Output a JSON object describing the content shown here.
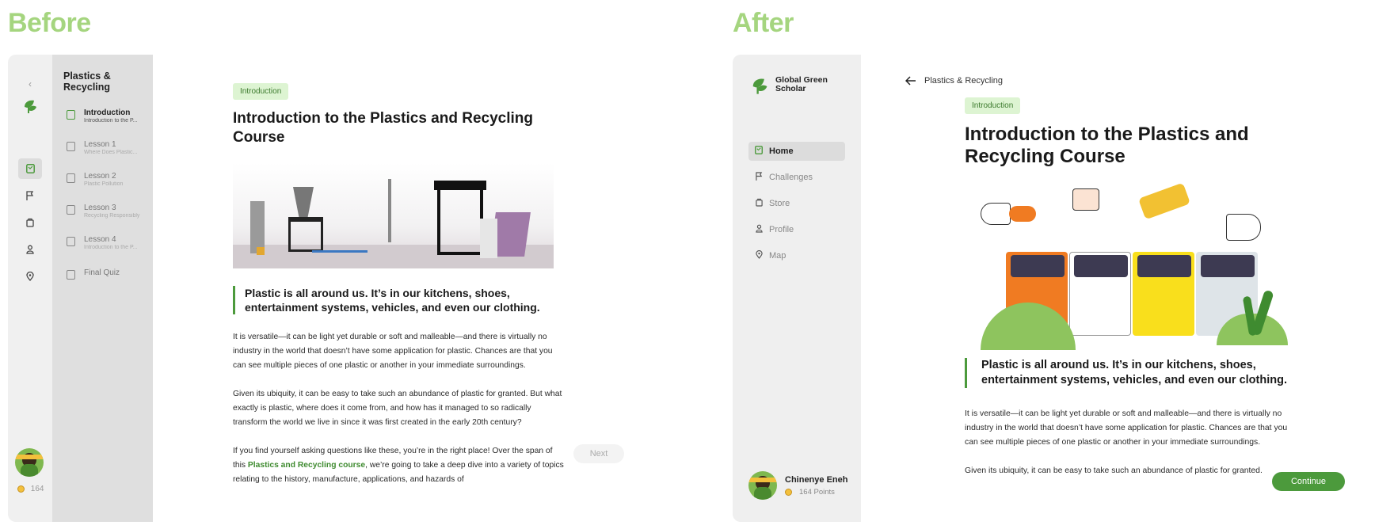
{
  "headings": {
    "before": "Before",
    "after": "After"
  },
  "before": {
    "course_title": "Plastics & Recycling",
    "lessons": [
      {
        "title": "Introduction",
        "subtitle": "Introduction to the P..."
      },
      {
        "title": "Lesson 1",
        "subtitle": "Where Does Plastic..."
      },
      {
        "title": "Lesson 2",
        "subtitle": "Plastic Pollution"
      },
      {
        "title": "Lesson 3",
        "subtitle": "Recycling Responsibly"
      },
      {
        "title": "Lesson 4",
        "subtitle": "Introduction to the P..."
      },
      {
        "title": "Final Quiz",
        "subtitle": ""
      }
    ],
    "points": "164",
    "badge": "Introduction",
    "title": "Introduction to the Plastics and Recycling Course",
    "quote": "Plastic is all around us. It’s in our kitchens, shoes, entertainment systems, vehicles, and even our clothing.",
    "para1": "It is versatile—it can be light yet durable or soft and malleable—and there is virtually no industry in the world that doesn’t have some application for plastic. Chances are that you can see multiple pieces of one plastic or another in your immediate surroundings.",
    "para2": "Given its ubiquity, it can be easy to take such an abundance of plastic for granted. But what exactly is plastic, where does it come from, and how has it managed to so radically transform the world we live in since it was first created in the early 20th century?",
    "para3_start": "If you find yourself asking questions like these, you’re in the right place! Over the span of this ",
    "para3_link": "Plastics and Recycling course",
    "para3_end": ", we’re going to take a deep dive into a variety of topics relating to the history, manufacture, applications, and hazards of",
    "next": "Next"
  },
  "after": {
    "brand": "Global Green Scholar",
    "nav": [
      "Home",
      "Challenges",
      "Store",
      "Profile",
      "Map"
    ],
    "user_name": "Chinenye Eneh",
    "user_points": "164 Points",
    "breadcrumb": "Plastics & Recycling",
    "badge": "Introduction",
    "title": "Introduction to the Plastics and Recycling Course",
    "quote": "Plastic is all around us. It’s in our kitchens, shoes, entertainment systems, vehicles, and even our clothing.",
    "para1": "It is versatile—it can be light yet durable or soft and malleable—and there is virtually no industry in the world that doesn’t have some application for plastic. Chances are that you can see multiple pieces of one plastic or another in your immediate surroundings.",
    "para2": "Given its ubiquity, it can be easy to take such an abundance of plastic for granted.",
    "continue": "Continue"
  },
  "colors": {
    "accent": "#4c9a3c",
    "heading": "#a5d57f",
    "badge_bg": "#ddf4d2"
  },
  "icons": [
    "chevron-left-icon",
    "leaf-logo-icon",
    "book-icon",
    "flag-icon",
    "bag-icon",
    "person-icon",
    "pin-icon",
    "arrow-left-icon",
    "coin-icon"
  ]
}
